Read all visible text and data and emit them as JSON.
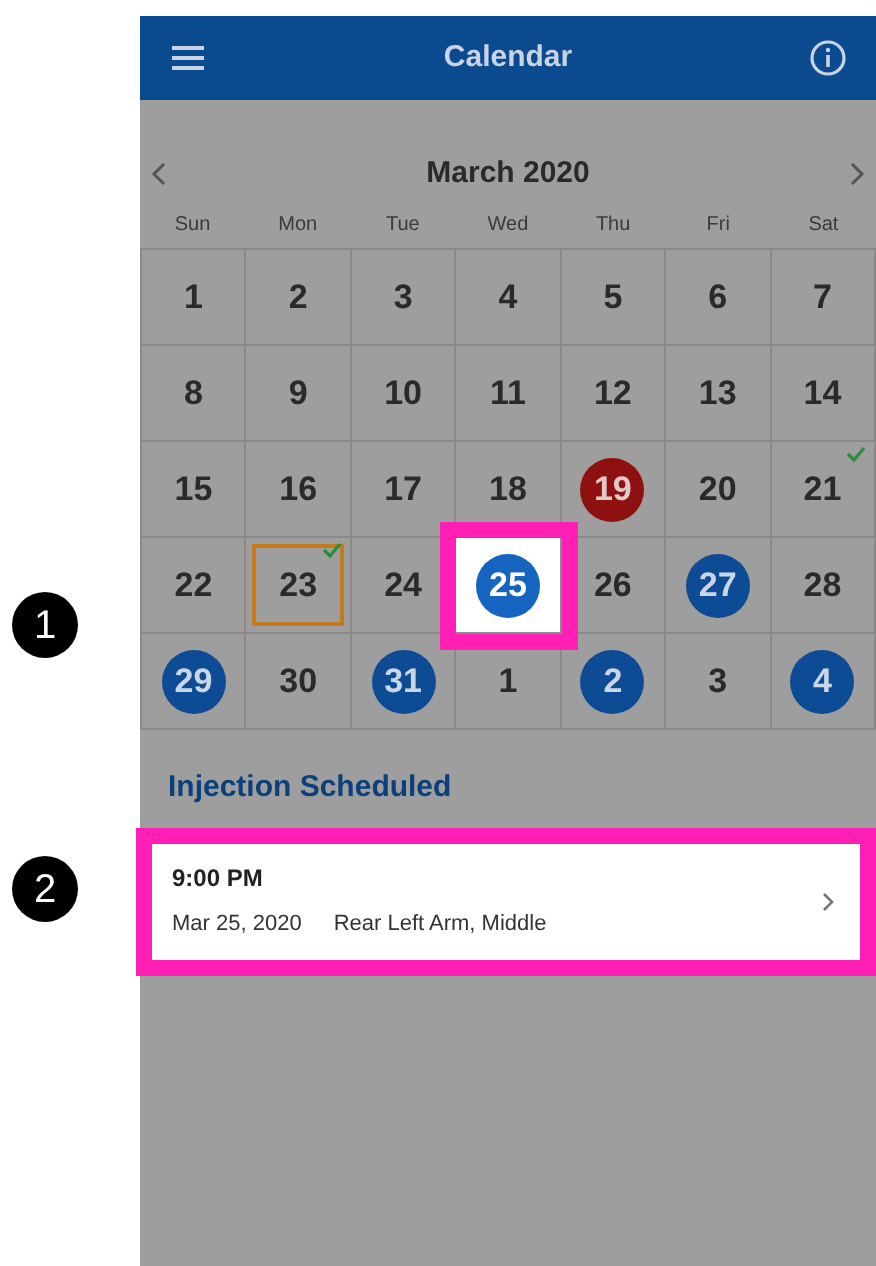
{
  "header": {
    "title": "Calendar"
  },
  "month": {
    "label": "March 2020"
  },
  "weekdays": [
    "Sun",
    "Mon",
    "Tue",
    "Wed",
    "Thu",
    "Fri",
    "Sat"
  ],
  "weeks": [
    [
      {
        "day": "1",
        "kind": "plain",
        "today": false,
        "checked": false,
        "highlighted": false
      },
      {
        "day": "2",
        "kind": "plain",
        "today": false,
        "checked": false,
        "highlighted": false
      },
      {
        "day": "3",
        "kind": "plain",
        "today": false,
        "checked": false,
        "highlighted": false
      },
      {
        "day": "4",
        "kind": "plain",
        "today": false,
        "checked": false,
        "highlighted": false
      },
      {
        "day": "5",
        "kind": "plain",
        "today": false,
        "checked": false,
        "highlighted": false
      },
      {
        "day": "6",
        "kind": "plain",
        "today": false,
        "checked": false,
        "highlighted": false
      },
      {
        "day": "7",
        "kind": "plain",
        "today": false,
        "checked": false,
        "highlighted": false
      }
    ],
    [
      {
        "day": "8",
        "kind": "plain",
        "today": false,
        "checked": false,
        "highlighted": false
      },
      {
        "day": "9",
        "kind": "plain",
        "today": false,
        "checked": false,
        "highlighted": false
      },
      {
        "day": "10",
        "kind": "plain",
        "today": false,
        "checked": false,
        "highlighted": false
      },
      {
        "day": "11",
        "kind": "plain",
        "today": false,
        "checked": false,
        "highlighted": false
      },
      {
        "day": "12",
        "kind": "plain",
        "today": false,
        "checked": false,
        "highlighted": false
      },
      {
        "day": "13",
        "kind": "plain",
        "today": false,
        "checked": false,
        "highlighted": false
      },
      {
        "day": "14",
        "kind": "plain",
        "today": false,
        "checked": false,
        "highlighted": false
      }
    ],
    [
      {
        "day": "15",
        "kind": "plain",
        "today": false,
        "checked": false,
        "highlighted": false
      },
      {
        "day": "16",
        "kind": "plain",
        "today": false,
        "checked": false,
        "highlighted": false
      },
      {
        "day": "17",
        "kind": "plain",
        "today": false,
        "checked": false,
        "highlighted": false
      },
      {
        "day": "18",
        "kind": "plain",
        "today": false,
        "checked": false,
        "highlighted": false
      },
      {
        "day": "19",
        "kind": "missed",
        "today": false,
        "checked": false,
        "highlighted": false
      },
      {
        "day": "20",
        "kind": "plain",
        "today": false,
        "checked": false,
        "highlighted": false
      },
      {
        "day": "21",
        "kind": "plain",
        "today": false,
        "checked": true,
        "highlighted": false
      }
    ],
    [
      {
        "day": "22",
        "kind": "plain",
        "today": false,
        "checked": false,
        "highlighted": false
      },
      {
        "day": "23",
        "kind": "plain",
        "today": true,
        "checked": true,
        "highlighted": false
      },
      {
        "day": "24",
        "kind": "plain",
        "today": false,
        "checked": false,
        "highlighted": false
      },
      {
        "day": "25",
        "kind": "scheduled",
        "today": false,
        "checked": false,
        "highlighted": true
      },
      {
        "day": "26",
        "kind": "plain",
        "today": false,
        "checked": false,
        "highlighted": false
      },
      {
        "day": "27",
        "kind": "scheduled",
        "today": false,
        "checked": false,
        "highlighted": false
      },
      {
        "day": "28",
        "kind": "plain",
        "today": false,
        "checked": false,
        "highlighted": false
      }
    ],
    [
      {
        "day": "29",
        "kind": "scheduled",
        "today": false,
        "checked": false,
        "highlighted": false
      },
      {
        "day": "30",
        "kind": "plain",
        "today": false,
        "checked": false,
        "highlighted": false
      },
      {
        "day": "31",
        "kind": "scheduled",
        "today": false,
        "checked": false,
        "highlighted": false
      },
      {
        "day": "1",
        "kind": "plain",
        "today": false,
        "checked": false,
        "highlighted": false
      },
      {
        "day": "2",
        "kind": "scheduled",
        "today": false,
        "checked": false,
        "highlighted": false
      },
      {
        "day": "3",
        "kind": "plain",
        "today": false,
        "checked": false,
        "highlighted": false
      },
      {
        "day": "4",
        "kind": "scheduled",
        "today": false,
        "checked": false,
        "highlighted": false
      }
    ]
  ],
  "section": {
    "title": "Injection Scheduled"
  },
  "appointments": [
    {
      "time": "9:00 PM",
      "date": "Mar 25, 2020",
      "site": "Rear Left Arm, Middle",
      "highlighted": true
    }
  ],
  "callouts": [
    {
      "number": "1"
    },
    {
      "number": "2"
    }
  ]
}
